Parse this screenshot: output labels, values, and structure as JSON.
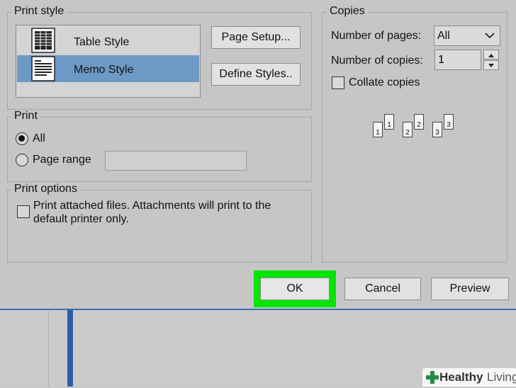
{
  "print_style": {
    "legend": "Print style",
    "items": [
      {
        "label": "Table Style",
        "selected": false,
        "icon": "table-style-icon"
      },
      {
        "label": "Memo Style",
        "selected": true,
        "icon": "memo-style-icon"
      }
    ],
    "page_setup_label": "Page Setup...",
    "define_styles_label": "Define Styles.."
  },
  "print": {
    "legend": "Print",
    "all_label": "All",
    "page_range_label": "Page range",
    "selected": "All",
    "page_range_value": ""
  },
  "print_options": {
    "legend": "Print options",
    "attached_line1": "Print attached files.  Attachments will print to the",
    "attached_line2": "default printer only.",
    "checked": false
  },
  "copies": {
    "legend": "Copies",
    "pages_label": "Number of pages:",
    "pages_value": "All",
    "copies_label": "Number of copies:",
    "copies_value": "1",
    "collate_label": "Collate copies",
    "collate_checked": false,
    "collate_numbers": [
      "1",
      "1",
      "2",
      "2",
      "3",
      "3"
    ]
  },
  "footer": {
    "ok_label": "OK",
    "cancel_label": "Cancel",
    "preview_label": "Preview",
    "highlight_color": "#00e600"
  },
  "watermark": {
    "text_bold": "Healthy",
    "text_light": "Living",
    "color": "#2a8a4a"
  },
  "colors": {
    "selection": "#6d9ac4",
    "dialog_bg": "#c6c6c6",
    "accent_blue": "#2f5ea8"
  }
}
